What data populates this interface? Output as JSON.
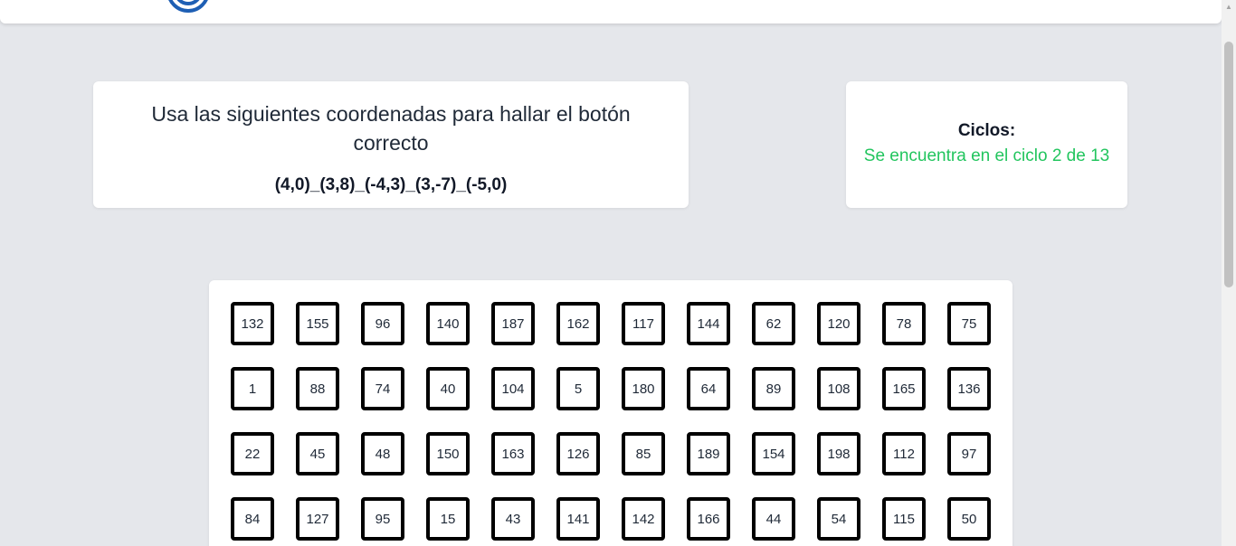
{
  "instruction": {
    "text": "Usa las siguientes coordenadas para hallar el botón correcto",
    "coordinates": "(4,0)_(3,8)_(-4,3)_(3,-7)_(-5,0)"
  },
  "cycles": {
    "label": "Ciclos:",
    "status": "Se encuentra en el ciclo 2 de 13",
    "status_color": "#22c55e"
  },
  "grid": {
    "rows": [
      [
        "132",
        "155",
        "96",
        "140",
        "187",
        "162",
        "117",
        "144",
        "62",
        "120",
        "78",
        "75"
      ],
      [
        "1",
        "88",
        "74",
        "40",
        "104",
        "5",
        "180",
        "64",
        "89",
        "108",
        "165",
        "136"
      ],
      [
        "22",
        "45",
        "48",
        "150",
        "163",
        "126",
        "85",
        "189",
        "154",
        "198",
        "112",
        "97"
      ],
      [
        "84",
        "127",
        "95",
        "15",
        "43",
        "141",
        "142",
        "166",
        "44",
        "54",
        "115",
        "50"
      ]
    ]
  },
  "logo_icon": "brand-logo-icon",
  "colors": {
    "background": "#e5e7eb",
    "logo": "#1e5fb4",
    "button_border": "#000000"
  }
}
